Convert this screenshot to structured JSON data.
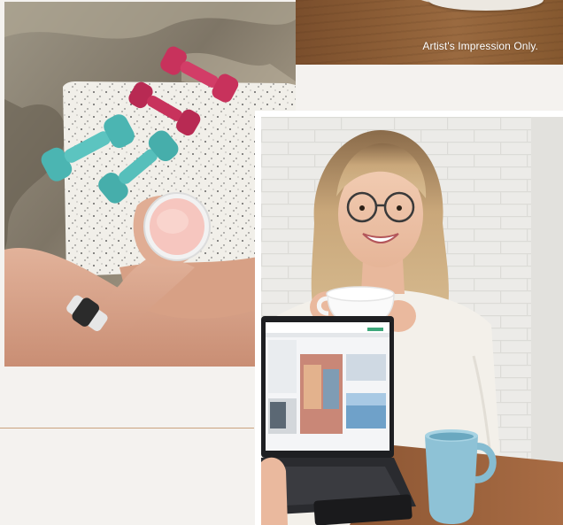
{
  "caption": {
    "impression": "Artist's Impression Only."
  },
  "images": {
    "top_photo": "wood-table-photo",
    "left_photo": "dumbbells-smoothie-photo",
    "right_photo": "woman-coffee-laptop-photo"
  },
  "colors": {
    "background": "#f4f2ef",
    "divider": "#c9a27e",
    "frame": "#ffffff"
  }
}
